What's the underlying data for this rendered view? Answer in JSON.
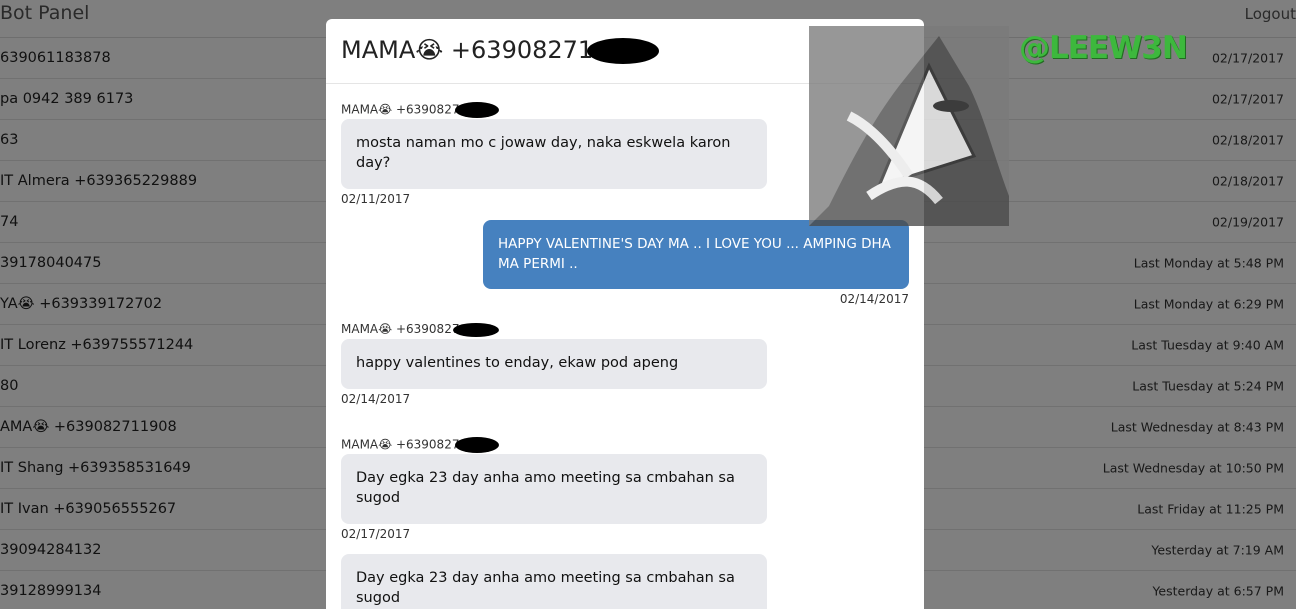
{
  "header": {
    "brand": "Bot Panel",
    "logout": "Logout"
  },
  "conversations": [
    {
      "name": "639061183878",
      "date": "02/17/2017"
    },
    {
      "name": "pa 0942 389 6173",
      "date": "02/17/2017"
    },
    {
      "name": "63",
      "date": "02/18/2017"
    },
    {
      "name": "IT Almera +639365229889",
      "date": "02/18/2017"
    },
    {
      "name": "74",
      "date": "02/19/2017"
    },
    {
      "name": "39178040475",
      "date": "Last Monday at 5:48 PM"
    },
    {
      "name": "YA😭 +639339172702",
      "date": "Last Monday at 6:29 PM"
    },
    {
      "name": "IT Lorenz +639755571244",
      "date": "Last Tuesday at 9:40 AM"
    },
    {
      "name": "80",
      "date": "Last Tuesday at 5:24 PM"
    },
    {
      "name": "AMA😭 +639082711908",
      "date": "Last Wednesday at 8:43 PM"
    },
    {
      "name": "IT Shang +639358531649",
      "date": "Last Wednesday at 10:50 PM"
    },
    {
      "name": "IT Ivan +639056555267",
      "date": "Last Friday at 11:25 PM"
    },
    {
      "name": "39094284132",
      "date": "Yesterday at 7:19 AM"
    },
    {
      "name": "39128999134",
      "date": "Yesterday at 6:57 PM"
    }
  ],
  "modal": {
    "title": "MAMA😭 +63908271",
    "messages": [
      {
        "author": "MAMA😭 +6390827",
        "text": "mosta naman mo c jowaw day, naka eskwela karon day?",
        "date": "02/11/2017"
      },
      {
        "text": "HAPPY VALENTINE'S DAY MA .. I LOVE YOU ... AMPING DHA MA PERMI ..",
        "date": "02/14/2017"
      },
      {
        "author": "MAMA😭 +6390827",
        "text": "happy valentines to enday, ekaw pod apeng",
        "date": "02/14/2017"
      },
      {
        "author": "MAMA😭 +6390827",
        "text": "Day egka 23 day anha amo meeting sa cmbahan sa sugod",
        "date": "02/17/2017"
      },
      {
        "text": "Day egka 23 day anha amo meeting sa cmbahan sa sugod"
      }
    ]
  },
  "watermark": {
    "text": "@LEEW3N",
    "color": "#3db83d"
  }
}
